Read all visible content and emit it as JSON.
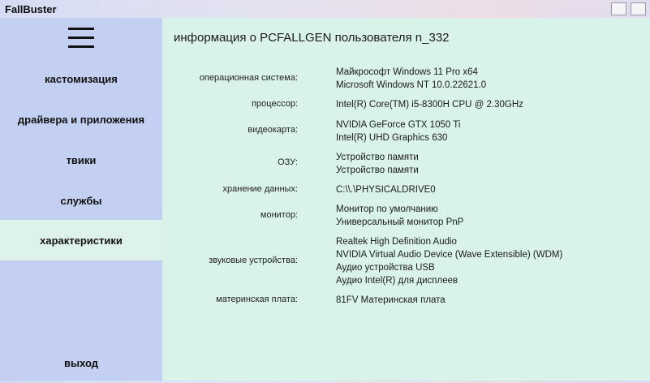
{
  "app": {
    "title": "FallBuster"
  },
  "sidebar": {
    "items": [
      {
        "label": "кастомизация",
        "active": false
      },
      {
        "label": "драйвера и приложения",
        "active": false
      },
      {
        "label": "твики",
        "active": false
      },
      {
        "label": "службы",
        "active": false
      },
      {
        "label": "характеристики",
        "active": true
      }
    ],
    "exit_label": "выход"
  },
  "content": {
    "title": "информация о PCFALLGEN пользователя n_332",
    "specs": [
      {
        "label": "операционная система:",
        "values": [
          "Майкрософт Windows 11 Pro x64",
          "Microsoft Windows NT 10.0.22621.0"
        ]
      },
      {
        "label": "процессор:",
        "values": [
          "Intel(R) Core(TM) i5-8300H CPU @ 2.30GHz"
        ]
      },
      {
        "label": "видеокарта:",
        "values": [
          "NVIDIA GeForce GTX 1050 Ti",
          "Intel(R) UHD Graphics 630"
        ]
      },
      {
        "label": "ОЗУ:",
        "values": [
          "Устройство памяти",
          "Устройство памяти"
        ]
      },
      {
        "label": "хранение данных:",
        "values": [
          "C:\\\\.\\PHYSICALDRIVE0"
        ]
      },
      {
        "label": "монитор:",
        "values": [
          "Монитор по умолчанию",
          "Универсальный монитор PnP"
        ]
      },
      {
        "label": "звуковые устройства:",
        "values": [
          "Realtek High Definition Audio",
          "NVIDIA Virtual Audio Device (Wave Extensible) (WDM)",
          "Аудио устройства USB",
          "Аудио Intel(R) для дисплеев"
        ]
      },
      {
        "label": "материнская плата:",
        "values": [
          "81FV Материнская плата"
        ]
      }
    ]
  }
}
